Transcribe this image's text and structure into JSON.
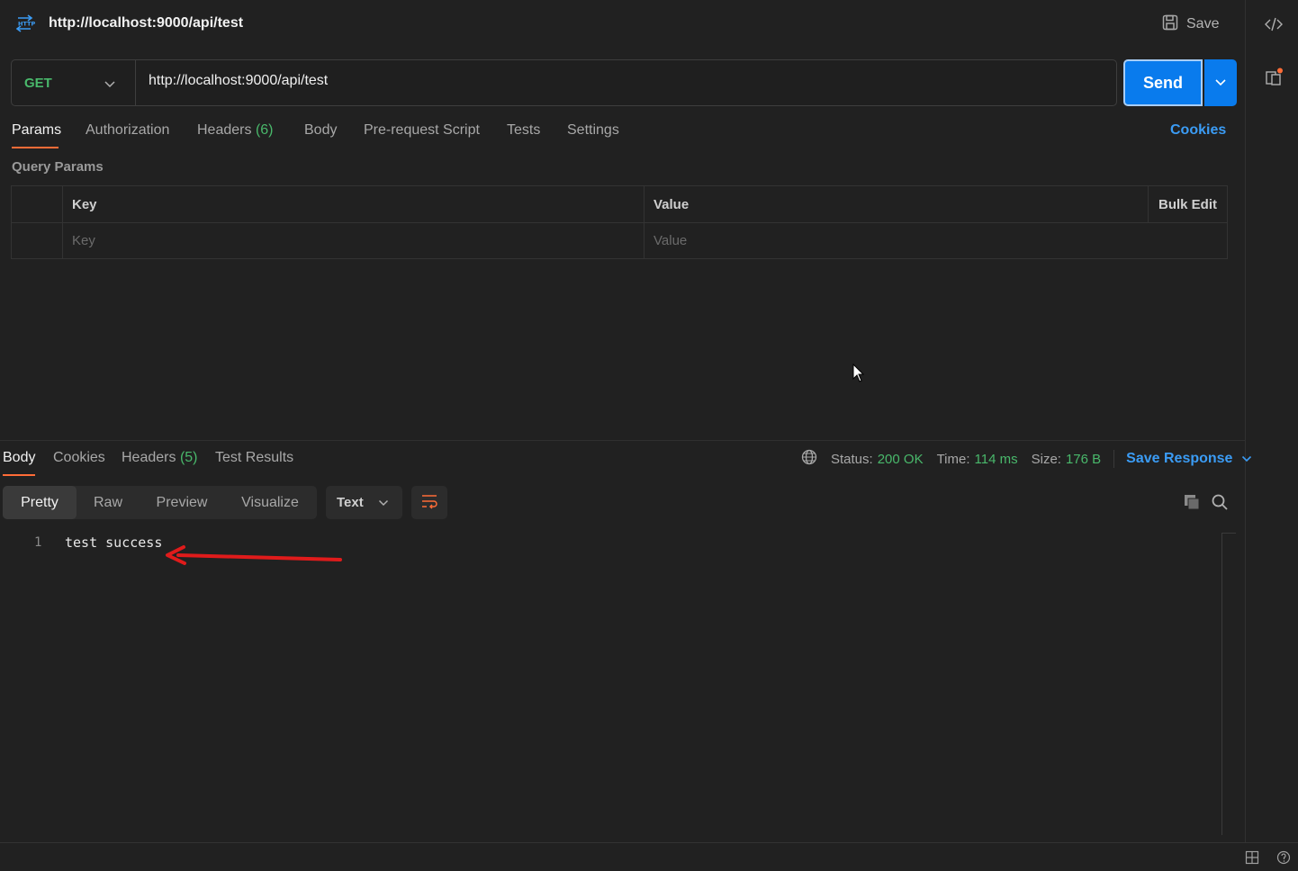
{
  "request": {
    "title": "http://localhost:9000/api/test",
    "save_label": "Save",
    "method": "GET",
    "url": "http://localhost:9000/api/test",
    "send_label": "Send"
  },
  "request_tabs": [
    {
      "label": "Params",
      "active": true
    },
    {
      "label": "Authorization"
    },
    {
      "label": "Headers",
      "count": "(6)"
    },
    {
      "label": "Body"
    },
    {
      "label": "Pre-request Script"
    },
    {
      "label": "Tests"
    },
    {
      "label": "Settings"
    }
  ],
  "cookies_label": "Cookies",
  "query_params": {
    "title": "Query Params",
    "col_key": "Key",
    "col_value": "Value",
    "bulk_edit": "Bulk Edit",
    "key_placeholder": "Key",
    "value_placeholder": "Value"
  },
  "response_tabs": [
    {
      "label": "Body",
      "active": true
    },
    {
      "label": "Cookies"
    },
    {
      "label": "Headers",
      "count": "(5)"
    },
    {
      "label": "Test Results"
    }
  ],
  "response_status": {
    "status_label": "Status:",
    "status_value": "200 OK",
    "time_label": "Time:",
    "time_value": "114 ms",
    "size_label": "Size:",
    "size_value": "176 B",
    "save_response": "Save Response"
  },
  "response_modes": [
    {
      "label": "Pretty",
      "active": true
    },
    {
      "label": "Raw"
    },
    {
      "label": "Preview"
    },
    {
      "label": "Visualize"
    }
  ],
  "response_format": "Text",
  "response_body": {
    "line_number": "1",
    "line_text": "test success"
  },
  "icons": {
    "http": "http-icon",
    "save": "floppy-disk-icon",
    "code": "code-icon",
    "docs": "document-info-icon",
    "globe": "globe-icon",
    "wrap": "wrap-lines-icon",
    "copy": "copy-icon",
    "search": "search-icon",
    "layout": "layout-icon",
    "help": "help-icon"
  },
  "colors": {
    "accent_orange": "#ff6c37",
    "send_blue": "#097bed",
    "link_blue": "#3b9cf5",
    "success_green": "#49b86b",
    "annotation_red": "#e01b1b"
  }
}
